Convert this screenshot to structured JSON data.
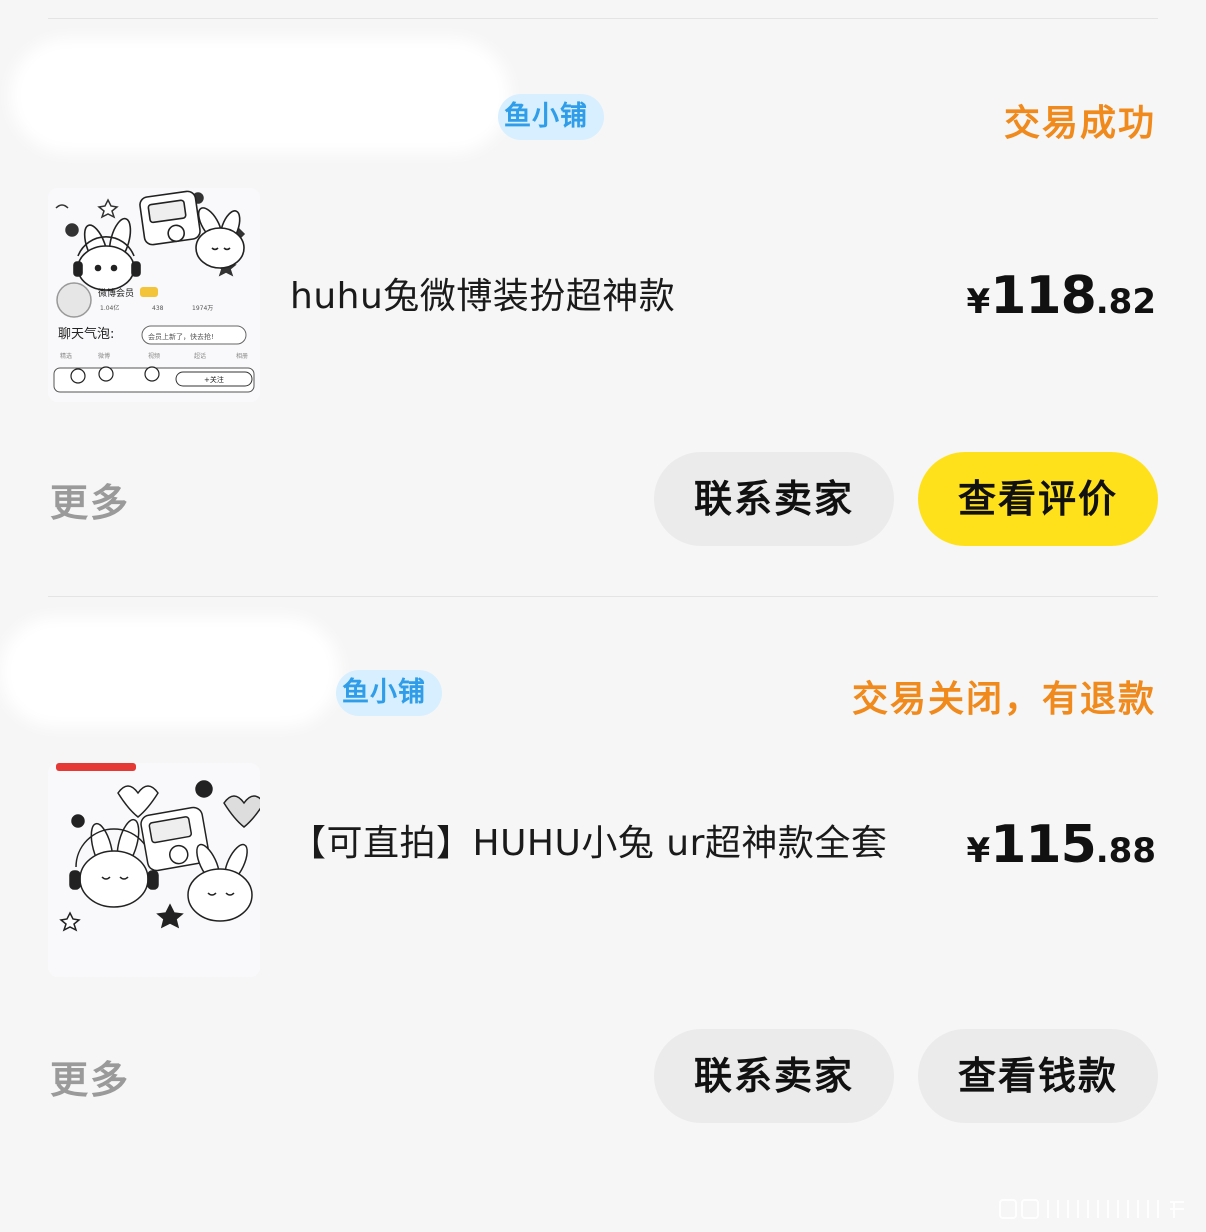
{
  "orders": [
    {
      "shop_badge": "鱼小铺",
      "status": "交易成功",
      "item_title": "huhu兔微博装扮超神款",
      "price": {
        "currency": "¥",
        "integer": "118",
        "decimal": ".82"
      },
      "more": "更多",
      "buttons": {
        "contact": "联系卖家",
        "secondary": "查看评价"
      },
      "thumbnail": {
        "member_label": "微博会员",
        "stats": [
          "1.04亿",
          "438",
          "1974万"
        ],
        "bubble_label": "聊天气泡:",
        "bubble_text": "会员上新了，快去抢!",
        "follow": "+关注"
      }
    },
    {
      "shop_badge": "鱼小铺",
      "status": "交易关闭，有退款",
      "item_title": "【可直拍】HUHU小兔 ur超神款全套",
      "price": {
        "currency": "¥",
        "integer": "115",
        "decimal": ".88"
      },
      "more": "更多",
      "buttons": {
        "contact": "联系卖家",
        "secondary": "查看钱款"
      }
    }
  ],
  "colors": {
    "status": "#f08a1c",
    "badge_bg": "#d7efff",
    "badge_text": "#2f9de8",
    "primary_button": "#ffe11b",
    "secondary_button": "#ebebeb",
    "background": "#f6f6f6"
  }
}
